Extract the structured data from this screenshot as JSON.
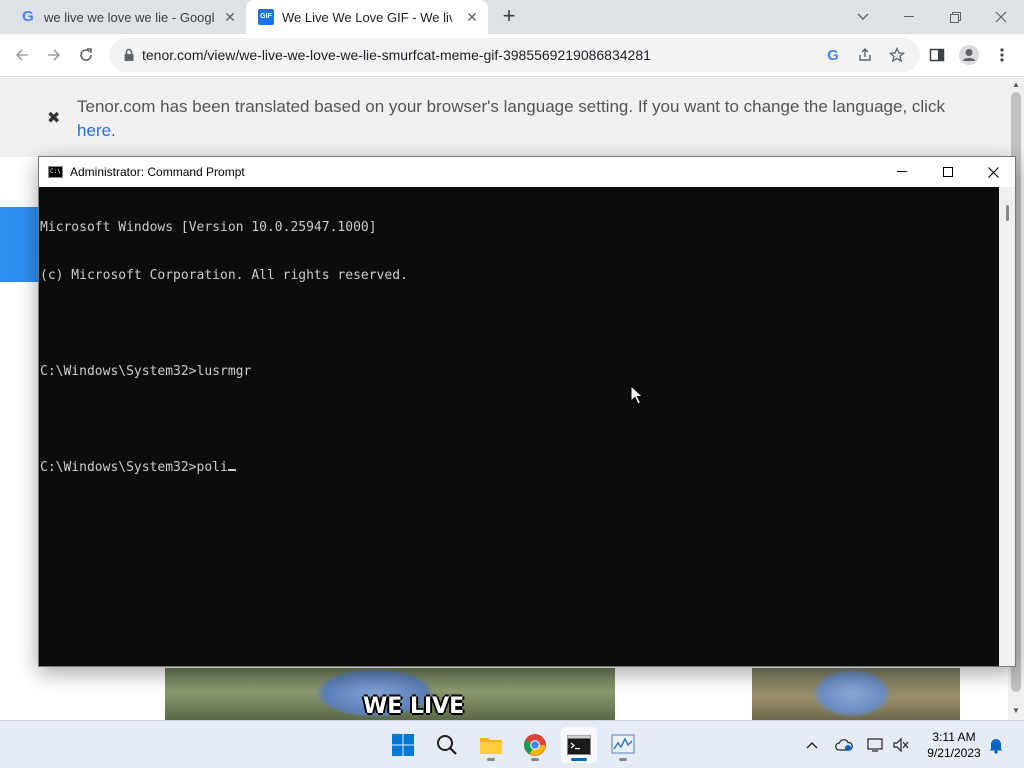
{
  "browser": {
    "tabs": [
      {
        "title": "we live we love we lie - Google S",
        "favicon": "google-icon",
        "active": false
      },
      {
        "title": "We Live We Love GIF - We live W",
        "favicon": "tenor-gif-icon",
        "active": true
      }
    ],
    "url": "tenor.com/view/we-live-we-love-we-lie-smurfcat-meme-gif-3985569219086834281",
    "new_tab_label": "+"
  },
  "translate_bar": {
    "message": "Tenor.com has been translated based on your browser's language setting. If you want to change the language, click",
    "link_text": "here",
    "suffix": "."
  },
  "page": {
    "gif_caption": "WE LIVE"
  },
  "cmd": {
    "title": "Administrator: Command Prompt",
    "lines": [
      "Microsoft Windows [Version 10.0.25947.1000]",
      "(c) Microsoft Corporation. All rights reserved.",
      "",
      "C:\\Windows\\System32>lusrmgr",
      "",
      "C:\\Windows\\System32>poli"
    ]
  },
  "taskbar": {
    "apps": [
      "windows-start-icon",
      "search-icon",
      "file-explorer-icon",
      "chrome-icon",
      "command-prompt-icon",
      "performance-monitor-icon"
    ],
    "time": "3:11 AM",
    "date": "9/21/2023"
  }
}
